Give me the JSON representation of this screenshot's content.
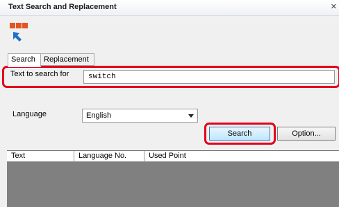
{
  "window": {
    "title": "Text Search and Replacement"
  },
  "tabs": [
    {
      "label": "Search",
      "active": true
    },
    {
      "label": "Replacement",
      "active": false
    }
  ],
  "search": {
    "label": "Text to search for",
    "value": "switch"
  },
  "language": {
    "label": "Language",
    "selected": "English"
  },
  "buttons": {
    "search": "Search",
    "option": "Option..."
  },
  "table": {
    "columns": [
      "Text",
      "Language No.",
      "Used Point"
    ]
  },
  "colors": {
    "highlight": "#e2001a",
    "table_background": "#808080"
  }
}
